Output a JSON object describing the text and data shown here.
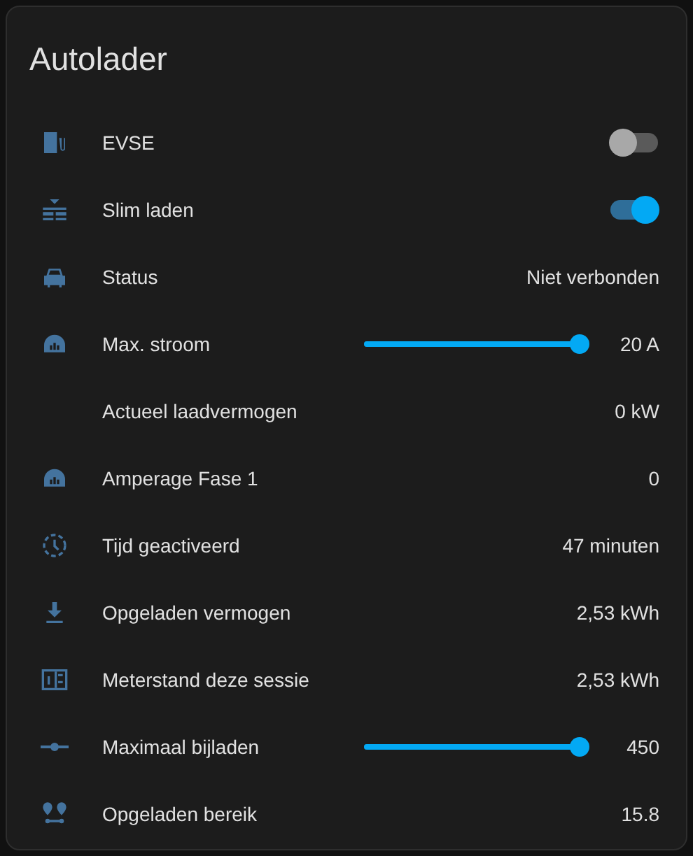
{
  "card": {
    "title": "Autolader"
  },
  "rows": [
    {
      "kind": "toggle",
      "label": "EVSE",
      "on": false
    },
    {
      "kind": "toggle",
      "label": "Slim laden",
      "on": true
    },
    {
      "kind": "text",
      "label": "Status",
      "value": "Niet verbonden"
    },
    {
      "kind": "slider",
      "label": "Max. stroom",
      "level": 1,
      "value": "20 A"
    },
    {
      "kind": "text",
      "label": "Actueel laadvermogen",
      "value": "0 kW"
    },
    {
      "kind": "text",
      "label": "Amperage Fase 1",
      "value": "0"
    },
    {
      "kind": "text",
      "label": "Tijd geactiveerd",
      "value": "47 minuten"
    },
    {
      "kind": "text",
      "label": "Opgeladen vermogen",
      "value": "2,53 kWh"
    },
    {
      "kind": "text",
      "label": "Meterstand deze sessie",
      "value": "2,53 kWh"
    },
    {
      "kind": "slider",
      "label": "Maximaal bijladen",
      "level": 1,
      "value": "450"
    },
    {
      "kind": "text",
      "label": "Opgeladen bereik",
      "value": "15.8"
    }
  ]
}
